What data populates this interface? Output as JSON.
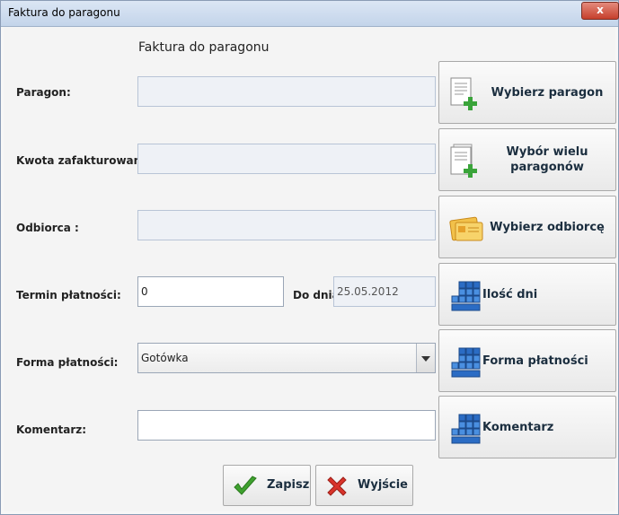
{
  "window": {
    "title": "Faktura do paragonu",
    "close_glyph": "x"
  },
  "form": {
    "heading": "Faktura do paragonu"
  },
  "fields": {
    "paragon": {
      "label": "Paragon:",
      "value": ""
    },
    "kwota": {
      "label": "Kwota zafakturowana:",
      "value": ""
    },
    "odbiorca": {
      "label": "Odbiorca :",
      "value": ""
    },
    "termin": {
      "label": "Termin płatności:",
      "value": "0",
      "do_dnia_label": "Do dnia:",
      "do_dnia_value": "25.05.2012"
    },
    "forma": {
      "label": "Forma płatności:",
      "value": "Gotówka"
    },
    "komentarz": {
      "label": "Komentarz:",
      "value": ""
    }
  },
  "buttons": {
    "wybierz_paragon": "Wybierz paragon",
    "wybor_wielu": "Wybór wielu paragonów",
    "wybierz_odbiorce": "Wybierz odbiorcę",
    "ilosc_dni": "Ilość dni",
    "forma_platnosci": "Forma płatności",
    "komentarz": "Komentarz",
    "zapisz": "Zapisz",
    "wyjscie": "Wyjście"
  },
  "icons": {
    "receipt": "receipt-add-icon",
    "receipts": "receipts-add-icon",
    "card": "card-icon",
    "keypad": "keypad-icon",
    "check": "check-icon",
    "cross": "cross-icon"
  },
  "colors": {
    "title_bar": "#c3d4ea",
    "close": "#c6402c",
    "check": "#3fa12f",
    "cross": "#d9342b"
  }
}
